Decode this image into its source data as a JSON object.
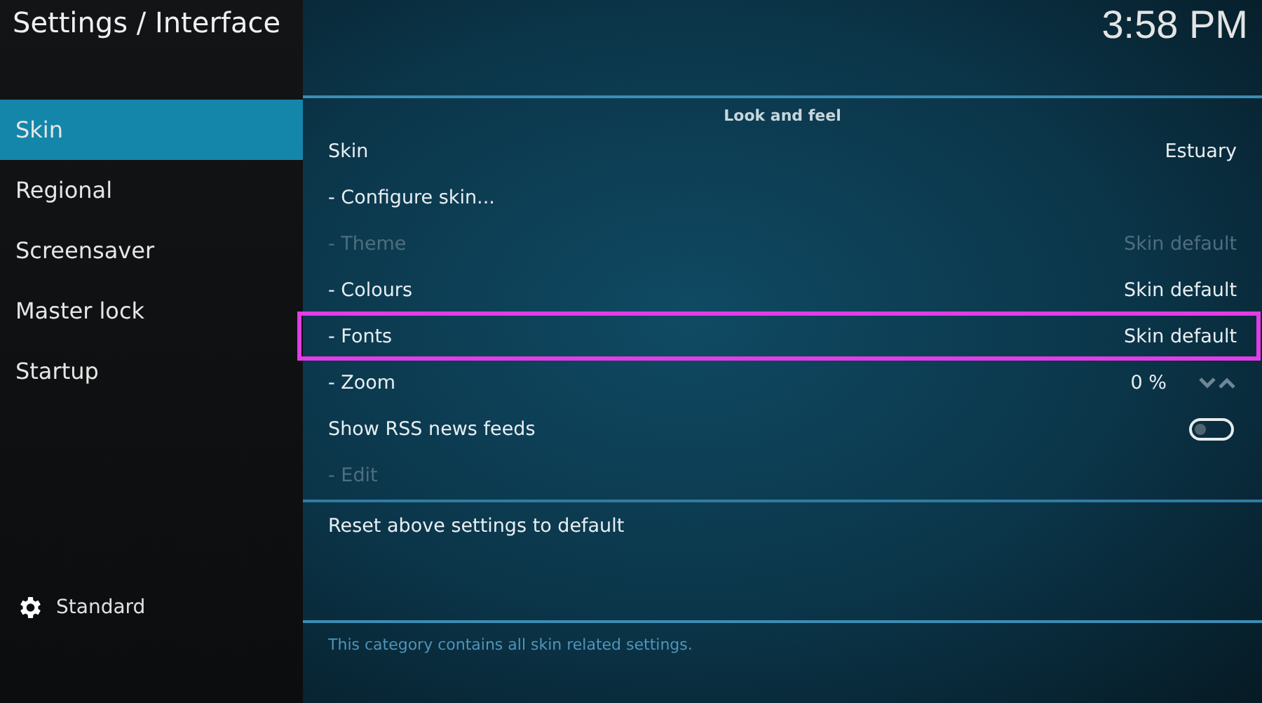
{
  "header": {
    "title": "Settings / Interface",
    "clock": "3:58 PM"
  },
  "sidebar": {
    "items": [
      {
        "label": "Skin",
        "selected": true
      },
      {
        "label": "Regional",
        "selected": false
      },
      {
        "label": "Screensaver",
        "selected": false
      },
      {
        "label": "Master lock",
        "selected": false
      },
      {
        "label": "Startup",
        "selected": false
      }
    ],
    "level_label": "Standard"
  },
  "section": {
    "heading": "Look and feel",
    "rows": [
      {
        "kind": "value",
        "label": "Skin",
        "value": "Estuary",
        "disabled": false,
        "highlighted": false
      },
      {
        "kind": "action",
        "label": "- Configure skin...",
        "disabled": false,
        "highlighted": false
      },
      {
        "kind": "value",
        "label": "- Theme",
        "value": "Skin default",
        "disabled": true,
        "highlighted": false
      },
      {
        "kind": "value",
        "label": "- Colours",
        "value": "Skin default",
        "disabled": false,
        "highlighted": false
      },
      {
        "kind": "value",
        "label": "- Fonts",
        "value": "Skin default",
        "disabled": false,
        "highlighted": true
      },
      {
        "kind": "spinner",
        "label": "- Zoom",
        "value": "0 %",
        "disabled": false,
        "highlighted": false
      },
      {
        "kind": "toggle",
        "label": "Show RSS news feeds",
        "on": false,
        "disabled": false,
        "highlighted": false
      },
      {
        "kind": "action",
        "label": "- Edit",
        "disabled": true,
        "highlighted": false
      }
    ],
    "reset": "Reset above settings to default"
  },
  "description": "This category contains all skin related settings."
}
